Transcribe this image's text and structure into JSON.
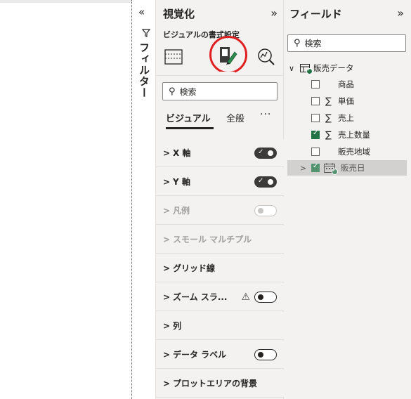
{
  "filters": {
    "label": "フィルター"
  },
  "visualizations": {
    "title": "視覚化",
    "subtitle": "ビジュアルの書式設定",
    "search_placeholder": "検索",
    "tabs": {
      "visual": "ビジュアル",
      "general": "全般",
      "more": "···"
    },
    "sections": [
      {
        "label": "X 軸",
        "toggle": "on",
        "disabled": false
      },
      {
        "label": "Y 軸",
        "toggle": "on",
        "disabled": false
      },
      {
        "label": "凡例",
        "toggle": "off",
        "disabled": true
      },
      {
        "label": "スモール マルチプル",
        "toggle": null,
        "disabled": true
      },
      {
        "label": "グリッド線",
        "toggle": null,
        "disabled": false
      },
      {
        "label": "ズーム スラ...",
        "toggle": "off",
        "disabled": false,
        "warning": true
      },
      {
        "label": "列",
        "toggle": null,
        "disabled": false
      },
      {
        "label": "データ ラベル",
        "toggle": "off",
        "disabled": false
      },
      {
        "label": "プロットエリアの背景",
        "toggle": null,
        "disabled": false
      }
    ]
  },
  "fields": {
    "title": "フィールド",
    "search_placeholder": "検索",
    "table_name": "販売データ",
    "items": [
      {
        "label": "商品",
        "checked": false,
        "sigma": false
      },
      {
        "label": "単価",
        "checked": false,
        "sigma": true
      },
      {
        "label": "売上",
        "checked": false,
        "sigma": true
      },
      {
        "label": "売上数量",
        "checked": true,
        "sigma": true
      },
      {
        "label": "販売地域",
        "checked": false,
        "sigma": false
      }
    ],
    "date_field": {
      "label": "販売日",
      "checked": true
    }
  },
  "colors": {
    "accent_green": "#217346",
    "highlight_red": "#e02020",
    "pane_bg": "#f3f2f1"
  }
}
